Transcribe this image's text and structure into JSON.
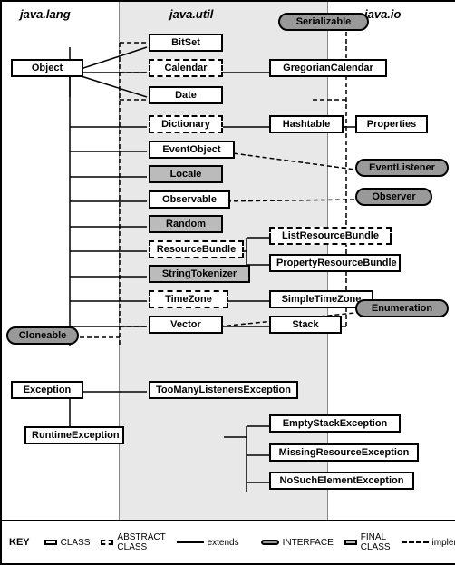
{
  "columns": {
    "lang": "java.lang",
    "util": "java.util",
    "io": "java.io"
  },
  "classes": {
    "object": "Object",
    "bitset": "BitSet",
    "calendar": "Calendar",
    "date": "Date",
    "dictionary": "Dictionary",
    "eventobject": "EventObject",
    "locale": "Locale",
    "observable": "Observable",
    "random": "Random",
    "resourcebundle": "ResourceBundle",
    "stringtokenizer": "StringTokenizer",
    "timezone": "TimeZone",
    "vector": "Vector",
    "gregoriancalendar": "GregorianCalendar",
    "hashtable": "Hashtable",
    "properties": "Properties",
    "listresourcebundle": "ListResourceBundle",
    "propertyresourcebundle": "PropertyResourceBundle",
    "simpletimezone": "SimpleTimeZone",
    "stack": "Stack",
    "cloneable": "Cloneable",
    "serializable": "Serializable",
    "eventlistener": "EventListener",
    "observer": "Observer",
    "enumeration": "Enumeration",
    "exception": "Exception",
    "runtimeexception": "RuntimeException",
    "toomanylistenersexception": "TooManyListenersException",
    "emptystackexception": "EmptyStackException",
    "missingresourceexception": "MissingResourceException",
    "nosuchelementexception": "NoSuchElementException"
  },
  "key": {
    "label": "KEY",
    "class": "CLASS",
    "abstract": "ABSTRACT CLASS",
    "interface": "INTERFACE",
    "final": "FINAL CLASS",
    "extends": "extends",
    "implements": "implements"
  }
}
